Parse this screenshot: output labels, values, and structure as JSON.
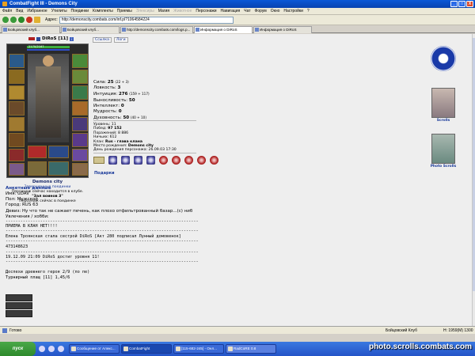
{
  "window": {
    "title": "CombatFight III - Demons City",
    "buttons": [
      "_",
      "□",
      "X"
    ]
  },
  "menu": {
    "items": [
      "Файл",
      "Вид",
      "Избранное",
      "Утилиты",
      "Поединки",
      "Комплекты",
      "Приемы",
      "Элексиры",
      "Магия",
      "Животное",
      "Персонажи",
      "Навигация",
      "Чат",
      "Форум",
      "Окно",
      "Настройки",
      "?"
    ],
    "disabled": [
      "Элексиры",
      "Животное"
    ]
  },
  "address": {
    "label": "Адрес:",
    "value": "http://demonscity.combats.com/inf.pl?1064584224"
  },
  "tabs": [
    {
      "label": "Бойцовский клуб...",
      "active": false
    },
    {
      "label": "Бойцовский клуб...",
      "active": false
    },
    {
      "label": "http://demonscity.combats.com/logs.p...",
      "active": false
    },
    {
      "label": "Информация о DiRoS",
      "active": true
    },
    {
      "label": "Информация о DiRoS",
      "active": false
    }
  ],
  "character": {
    "name": "DiRoS [11]",
    "hp": "2170/2167",
    "city": "Demons city",
    "fight_link": "Завершенные поединки",
    "location_prefix": "Персонаж сейчас находится в клубе.",
    "room": "\"Зал воинов 3\"",
    "fight_status": "Персонаж сейчас в поединке"
  },
  "controls": {
    "link": "Ссылка",
    "logs": "Логи"
  },
  "stats": [
    {
      "label": "Сила:",
      "value": "25",
      "extra": "(22 + 3)"
    },
    {
      "label": "Ловкость:",
      "value": "3",
      "extra": ""
    },
    {
      "label": "Интуиция:",
      "value": "276",
      "extra": "(159 + 117)"
    },
    {
      "label": "Выносливость:",
      "value": "50",
      "extra": ""
    },
    {
      "label": "Интеллект:",
      "value": "0",
      "extra": ""
    },
    {
      "label": "Мудрость:",
      "value": "0",
      "extra": ""
    },
    {
      "label": "Духовность:",
      "value": "50",
      "extra": "(40 + 10)"
    }
  ],
  "info_lines": [
    {
      "label": "Уровень:",
      "value": "11"
    },
    {
      "label": "Побед:",
      "value": "97 152"
    },
    {
      "label": "Поражений:",
      "value": "8 886"
    },
    {
      "label": "Ничьих:",
      "value": "612"
    },
    {
      "label": "Клан:",
      "value": "Rus - глава клана"
    },
    {
      "label": "Место рождения:",
      "value": "Demons city"
    },
    {
      "label": "День рождения персонажа:",
      "value": "26.09.03 17:30"
    }
  ],
  "gifts_label": "Подарки",
  "right_panel": {
    "scrolls_label": "Scrolls",
    "photo_scrolls_label": "Photo Scrolls"
  },
  "profile": {
    "section_title": "Анкетные данные",
    "name": "Имя: uDAV",
    "gender": "Пол: Мужской",
    "city": "Город: RUS 63",
    "motto": "Девиз: Ну что так не сажает печень, как плохо отфильтрованный базар...(с) ниб",
    "hobbies": "Увлечения / хобби:",
    "sep": "------------------------------------------------------------------------------",
    "clan_accept": "ПРИЕМА В КЛАН НЕТ!!!!",
    "sister": "Елена Троянская стала сестрой DiRoS [Акт 280 подписал Лунный домовенок]",
    "id": "473148623",
    "level_up": "19.12.09 21:09 DiRoS достиг уровня 11!",
    "armor": "Доспехи древнего героя 2/9 (по пе)",
    "cloak": "Турнирный плащ [11] 1,45/6"
  },
  "status": {
    "text": "Готово",
    "zone": "Бойцовский Клуб",
    "mem": "Н: 1959(М) 1300"
  },
  "taskbar": {
    "start": "пуск",
    "tasks": [
      {
        "label": "Сообщение от Алекс...",
        "state": "normal"
      },
      {
        "label": "CombatFight",
        "state": "active"
      },
      {
        "label": "[115-682-245] - Онл...",
        "state": "normal"
      },
      {
        "label": "RadCoRE 0.8",
        "state": "dim"
      }
    ],
    "watermark": "photo.scrolls.combats.com"
  }
}
